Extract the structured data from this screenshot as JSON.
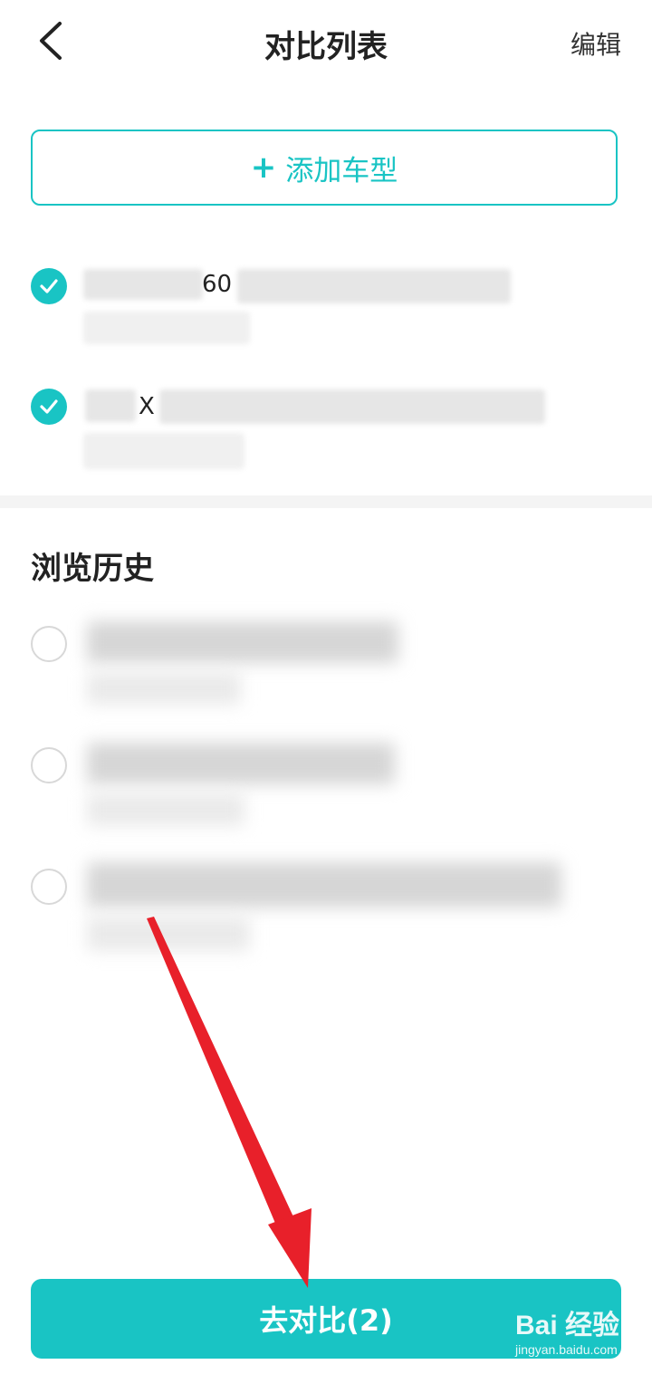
{
  "header": {
    "title": "对比列表",
    "edit_label": "编辑",
    "back_icon": "chevron-left-icon"
  },
  "add_button": {
    "icon": "plus-icon",
    "label": "添加车型"
  },
  "compare_list": [
    {
      "checked": true,
      "visible_fragment": "60"
    },
    {
      "checked": true,
      "visible_fragment": "X"
    }
  ],
  "history": {
    "title": "浏览历史",
    "items": [
      {
        "checked": false
      },
      {
        "checked": false
      },
      {
        "checked": false
      }
    ]
  },
  "compare_button": {
    "label": "去对比(2)"
  },
  "watermark": {
    "logo_text": "Bai 经验",
    "url": "jingyan.baidu.com"
  },
  "colors": {
    "accent": "#19c4c4",
    "annotation_arrow": "#e8202a"
  }
}
